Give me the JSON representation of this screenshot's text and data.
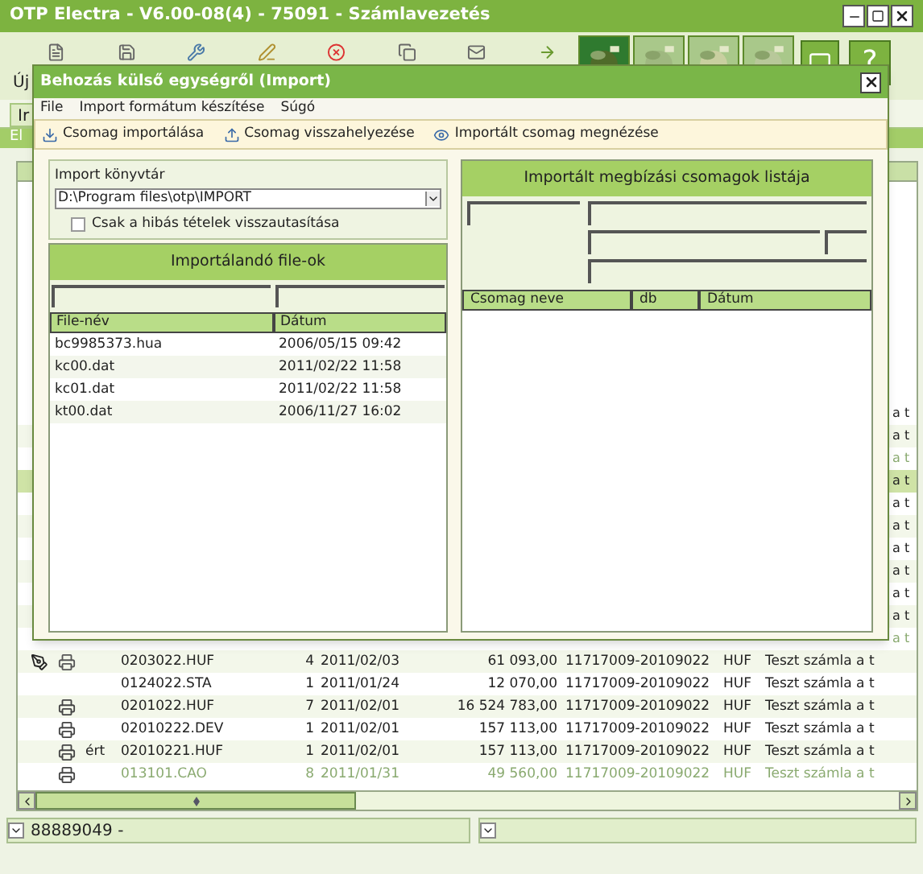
{
  "window": {
    "title": "OTP Electra - V6.00-08(4) - 75091 - Számlavezetés"
  },
  "toolbar": {
    "label": "Új",
    "help": "?"
  },
  "tab": {
    "label": "Ir"
  },
  "section": {
    "label": "El"
  },
  "table": {
    "rows": [
      {
        "kind": "partial",
        "description": "a t",
        "dimmed": false,
        "selected": false
      },
      {
        "kind": "partial",
        "description": "a t",
        "dimmed": false,
        "selected": false
      },
      {
        "kind": "partial",
        "description": "a t",
        "dimmed": true,
        "selected": false
      },
      {
        "kind": "partial",
        "description": "a t",
        "dimmed": false,
        "selected": true
      },
      {
        "kind": "partial",
        "description": "a t",
        "dimmed": false,
        "selected": false
      },
      {
        "kind": "partial",
        "description": "a t",
        "dimmed": false,
        "selected": false
      },
      {
        "kind": "partial",
        "description": "a t",
        "dimmed": false,
        "selected": false
      },
      {
        "kind": "partial",
        "description": "a t",
        "dimmed": false,
        "selected": false
      },
      {
        "kind": "partial",
        "description": "a t",
        "dimmed": false,
        "selected": false
      },
      {
        "kind": "partial",
        "description": "a t",
        "dimmed": false,
        "selected": false
      },
      {
        "kind": "partial",
        "description": "a t",
        "dimmed": true,
        "selected": false
      },
      {
        "kind": "signed",
        "note": "",
        "file": "0203022.HUF",
        "count": "4",
        "date": "2011/02/03",
        "amount": "61 093,00",
        "account": "11717009-20109022",
        "currency": "HUF",
        "description": "Teszt számla a t",
        "dimmed": false,
        "selected": false
      },
      {
        "kind": "plain",
        "note": "",
        "file": "0124022.STA",
        "count": "1",
        "date": "2011/01/24",
        "amount": "12 070,00",
        "account": "11717009-20109022",
        "currency": "HUF",
        "description": "Teszt számla a t",
        "dimmed": false,
        "selected": false
      },
      {
        "kind": "printed",
        "note": "",
        "file": "0201022.HUF",
        "count": "7",
        "date": "2011/02/01",
        "amount": "16 524 783,00",
        "account": "11717009-20109022",
        "currency": "HUF",
        "description": "Teszt számla a t",
        "dimmed": false,
        "selected": false
      },
      {
        "kind": "printed",
        "note": "",
        "file": "02010222.DEV",
        "count": "1",
        "date": "2011/02/01",
        "amount": "157 113,00",
        "account": "11717009-20109022",
        "currency": "HUF",
        "description": "Teszt számla a t",
        "dimmed": false,
        "selected": false
      },
      {
        "kind": "printed",
        "note": "ért",
        "file": "02010221.HUF",
        "count": "1",
        "date": "2011/02/01",
        "amount": "157 113,00",
        "account": "11717009-20109022",
        "currency": "HUF",
        "description": "Teszt számla a t",
        "dimmed": false,
        "selected": false
      },
      {
        "kind": "printed",
        "note": "",
        "file": "013101.CAO",
        "count": "8",
        "date": "2011/01/31",
        "amount": "49 560,00",
        "account": "11717009-20109022",
        "currency": "HUF",
        "description": "Teszt számla a t",
        "dimmed": true,
        "selected": false
      }
    ]
  },
  "status_bar": {
    "value": "88889049 -"
  },
  "dialog": {
    "title": "Behozás külső egységről (Import)",
    "menu": [
      "File",
      "Import formátum készítése",
      "Súgó"
    ],
    "actions": [
      "Csomag importálása",
      "Csomag visszahelyezése",
      "Importált csomag megnézése"
    ],
    "import_dir": {
      "label": "Import könyvtár",
      "value": "D:\\Program files\\otp\\IMPORT"
    },
    "reject_checkbox": {
      "label": "Csak a hibás tételek visszautasítása",
      "checked": false
    },
    "files_panel": {
      "title": "Importálandó file-ok",
      "columns": [
        "File-név",
        "Dátum"
      ],
      "rows": [
        [
          "bc9985373.hua",
          "2006/05/15 09:42"
        ],
        [
          "kc00.dat",
          "2011/02/22 11:58"
        ],
        [
          "kc01.dat",
          "2011/02/22 11:58"
        ],
        [
          "kt00.dat",
          "2006/11/27 16:02"
        ]
      ]
    },
    "packages_panel": {
      "title": "Importált megbízási csomagok listája",
      "columns": [
        "Csomag neve",
        "db",
        "Dátum"
      ]
    }
  }
}
